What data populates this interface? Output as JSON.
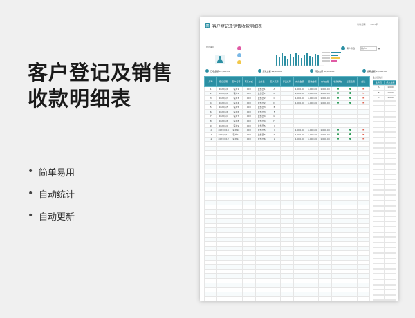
{
  "headline": [
    "客户登记及销售",
    "收款明细表"
  ],
  "features": [
    {
      "label": "简单易用"
    },
    {
      "label": "自动统计"
    },
    {
      "label": "自动更新"
    }
  ],
  "sheet": {
    "title": "客户登记及销售收款明细表",
    "logo_text": "表",
    "meta": [
      "制表日期",
      "2023年"
    ],
    "panel_label": "累计客户",
    "filter_label": "客户筛选",
    "filter_value": "客户1",
    "summary": [
      "已收金额 21,600.00",
      "应收金额 21,600.00",
      "待收金额 10,000.00",
      "逾期金额 10,000.00"
    ],
    "columns": [
      "序号",
      "登记日期",
      "客户名称",
      "联系方式",
      "业务员",
      "客户来源",
      "产品名称",
      "成交金额",
      "已收金额",
      "未收金额",
      "到期日",
      "收款状态",
      "是否逾期",
      "备注"
    ],
    "status_header": [
      "收款状态",
      "收款状态",
      "是否逾期"
    ],
    "rows": [
      [
        "1",
        "2023/1/1",
        "客户1",
        "XXX",
        "业务员1",
        "A",
        "1,000.00",
        "1,000.00",
        "1,000.00",
        "1,000.00"
      ],
      [
        "2",
        "2023/1/2",
        "客户2",
        "XXX",
        "业务员1",
        "B",
        "1,000.00",
        "1,000.00",
        "1,000.00",
        "1,000.00"
      ],
      [
        "3",
        "2023/1/3",
        "客户3",
        "XXX",
        "业务员2",
        "C",
        "1,000.00",
        "1,000.00",
        "1,000.00",
        "1,000.00"
      ],
      [
        "4",
        "2023/1/4",
        "客户4",
        "XXX",
        "业务员2",
        "D",
        "1,000.00",
        "1,000.00",
        "1,000.00",
        "1,000.00"
      ],
      [
        "5",
        "2023/1/5",
        "客户5",
        "XXX",
        "业务员3",
        "E",
        "",
        "",
        "",
        ""
      ],
      [
        "6",
        "2023/1/6",
        "客户6",
        "XXX",
        "业务员3",
        "F",
        "",
        "",
        "",
        ""
      ],
      [
        "7",
        "2023/1/7",
        "客户7",
        "XXX",
        "业务员4",
        "G",
        "",
        "",
        "",
        ""
      ],
      [
        "8",
        "2023/1/8",
        "客户8",
        "XXX",
        "业务员4",
        "H",
        "",
        "",
        "",
        ""
      ],
      [
        "9",
        "2023/1/9",
        "客户9",
        "XXX",
        "业务员5",
        "I",
        "",
        "",
        "",
        ""
      ],
      [
        "10",
        "2023/1/10",
        "客户10",
        "XXX",
        "业务员5",
        "J",
        "1,000.00",
        "1,000.00",
        "1,000.00",
        "1,000.00"
      ],
      [
        "11",
        "2023/1/11",
        "客户11",
        "XXX",
        "业务员6",
        "K",
        "1,000.00",
        "1,000.00",
        "1,000.00",
        "1,000.00"
      ],
      [
        "12",
        "2023/1/12",
        "客户12",
        "XXX",
        "业务员6",
        "L",
        "1,000.00",
        "1,000.00",
        "1,000.00",
        "1,000.00"
      ]
    ],
    "side_title": "业务员统计",
    "side_head": [
      "业务员",
      "成交金额"
    ],
    "side_rows": [
      [
        "A",
        "1,000"
      ],
      [
        "B",
        "1,000"
      ],
      [
        "C",
        "1,000"
      ]
    ],
    "colors": {
      "accent": "#2b8fa3",
      "kpi": [
        "#e05aa4",
        "#7ab8e6",
        "#f2c84b"
      ],
      "bars": "#2b8fa3"
    }
  }
}
